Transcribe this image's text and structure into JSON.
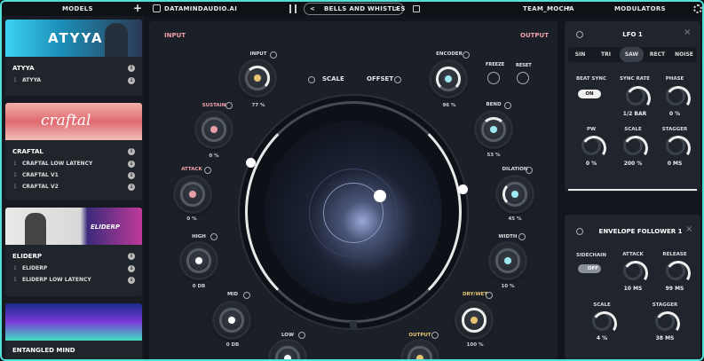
{
  "topbar": {
    "models": "MODELS",
    "plus": "+",
    "brand": "DATAMINDAUDIO.AI",
    "preset": "BELLS AND WHISTLES",
    "prev": "<",
    "next": ">",
    "user": "TEAM_MOCHA",
    "help": "?",
    "modulators": "MODULATORS"
  },
  "models": [
    {
      "title": "ATYYA",
      "image_text": "ATYYA",
      "variants": [
        "ATYYA"
      ]
    },
    {
      "title": "CRAFTAL",
      "image_text": "craftal",
      "variants": [
        "CRAFTAL LOW LATENCY",
        "CRAFTAL V1",
        "CRAFTAL V2"
      ]
    },
    {
      "title": "ELIDERP",
      "image_text": "ELIDERP",
      "variants": [
        "ELIDERP",
        "ELIDERP LOW LATENCY"
      ]
    },
    {
      "title": "ENTANGLED MIND",
      "variants": []
    }
  ],
  "main": {
    "input": "INPUT",
    "output": "OUTPUT",
    "scale": "SCALE",
    "offset": "OFFSET",
    "freeze": "FREEZE",
    "reset": "RESET",
    "knobs": {
      "input": {
        "label": "INPUT",
        "value": "77 %"
      },
      "sustain": {
        "label": "SUSTAIN",
        "value": "0 %"
      },
      "attack": {
        "label": "ATTACK",
        "value": "0 %"
      },
      "high": {
        "label": "HIGH",
        "value": "0 DB"
      },
      "mid": {
        "label": "MID",
        "value": "0 DB"
      },
      "low": {
        "label": "LOW",
        "value": ""
      },
      "encoder": {
        "label": "ENCODER",
        "value": "96 %"
      },
      "bend": {
        "label": "BEND",
        "value": "53 %"
      },
      "dilation": {
        "label": "DILATION",
        "value": "45 %"
      },
      "width": {
        "label": "WIDTH",
        "value": "10 %"
      },
      "drywet": {
        "label": "DRY/WET",
        "value": "100 %"
      },
      "outputk": {
        "label": "OUTPUT",
        "value": ""
      }
    }
  },
  "lfo": {
    "title": "LFO 1",
    "close": "×",
    "tabs": [
      "SIN",
      "TRI",
      "SAW",
      "RECT",
      "NOISE"
    ],
    "selected_tab": "SAW",
    "beat_sync": "BEAT SYNC",
    "beat_sync_state": "ON",
    "sync_rate": "SYNC RATE",
    "sync_rate_value": "1/2 BAR",
    "phase": "PHASE",
    "phase_value": "0 %",
    "pw": "PW",
    "pw_value": "0 %",
    "scale": "SCALE",
    "scale_value": "200 %",
    "stagger": "STAGGER",
    "stagger_value": "0 MS"
  },
  "env": {
    "title": "ENVELOPE FOLLOWER 1",
    "close": "×",
    "sidechain": "SIDECHAIN",
    "sidechain_state": "OFF",
    "attack": "ATTACK",
    "attack_value": "10 MS",
    "release": "RELEASE",
    "release_value": "99 MS",
    "scale": "SCALE",
    "scale_value": "4 %",
    "stagger": "STAGGER",
    "stagger_value": "38 MS"
  },
  "colors": {
    "accent": "#52e0d8",
    "input_dot": "#e8c572",
    "left_dot": "#e8a0a8",
    "right_dot": "#9ee8f0"
  }
}
